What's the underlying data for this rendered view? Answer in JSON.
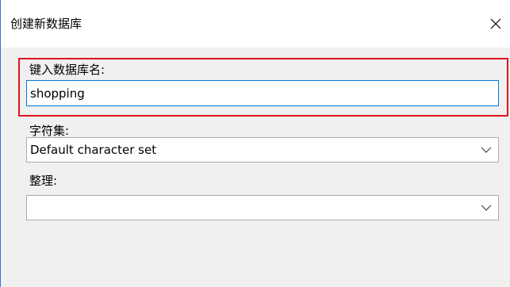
{
  "dialog": {
    "title": "创建新数据库",
    "close_icon": "close-icon"
  },
  "fields": {
    "database_name": {
      "label": "键入数据库名:",
      "value": "shopping"
    },
    "charset": {
      "label": "字符集:",
      "value": "Default character set",
      "icon": "chevron-down-icon"
    },
    "collation": {
      "label": "整理:",
      "value": "",
      "icon": "chevron-down-icon"
    }
  },
  "colors": {
    "highlight": "#e0141e",
    "focus_border": "#0078d7",
    "window_border": "#2b79d8",
    "content_bg": "#f0f0f0"
  }
}
